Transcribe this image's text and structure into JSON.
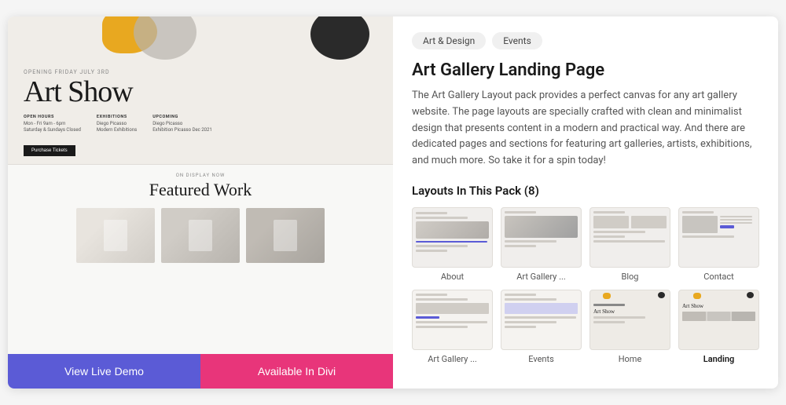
{
  "card": {
    "left": {
      "preview": {
        "opening_text": "OPENING FRIDAY JULY 3RD",
        "title": "Art Show",
        "info": [
          {
            "label": "OPEN HOURS",
            "lines": [
              "Mon - Fri 9am - 6pm",
              "Saturday & Sundays Closed"
            ]
          },
          {
            "label": "EXHIBITIONS",
            "lines": [
              "Diego Picasso",
              "Modern Exhibitions"
            ]
          },
          {
            "label": "UPCOMING",
            "lines": [
              "Diego Picasso",
              "Exhibition Picasso Dec 2021"
            ]
          }
        ],
        "purchase_btn": "Purchase Tickets",
        "featured_on_display": "ON DISPLAY NOW",
        "featured_title": "Featured Work"
      },
      "buttons": {
        "demo": "View Live Demo",
        "divi": "Available In Divi"
      }
    },
    "right": {
      "tags": [
        "Art & Design",
        "Events"
      ],
      "title": "Art Gallery Landing Page",
      "description": "The Art Gallery Layout pack provides a perfect canvas for any art gallery website. The page layouts are specially crafted with clean and minimalist design that presents content in a modern and practical way. And there are dedicated pages and sections for featuring art galleries, artists, exhibitions, and much more. So take it for a spin today!",
      "layouts_title": "Layouts In This Pack (8)",
      "layouts": [
        {
          "label": "About",
          "style": "about"
        },
        {
          "label": "Art Gallery ...",
          "style": "artgallery"
        },
        {
          "label": "Blog",
          "style": "blog"
        },
        {
          "label": "Contact",
          "style": "contact"
        },
        {
          "label": "Art Gallery ...",
          "style": "events"
        },
        {
          "label": "Events",
          "style": "events2"
        },
        {
          "label": "Home",
          "style": "artshow"
        },
        {
          "label": "Landing",
          "style": "artshow2"
        }
      ]
    }
  }
}
